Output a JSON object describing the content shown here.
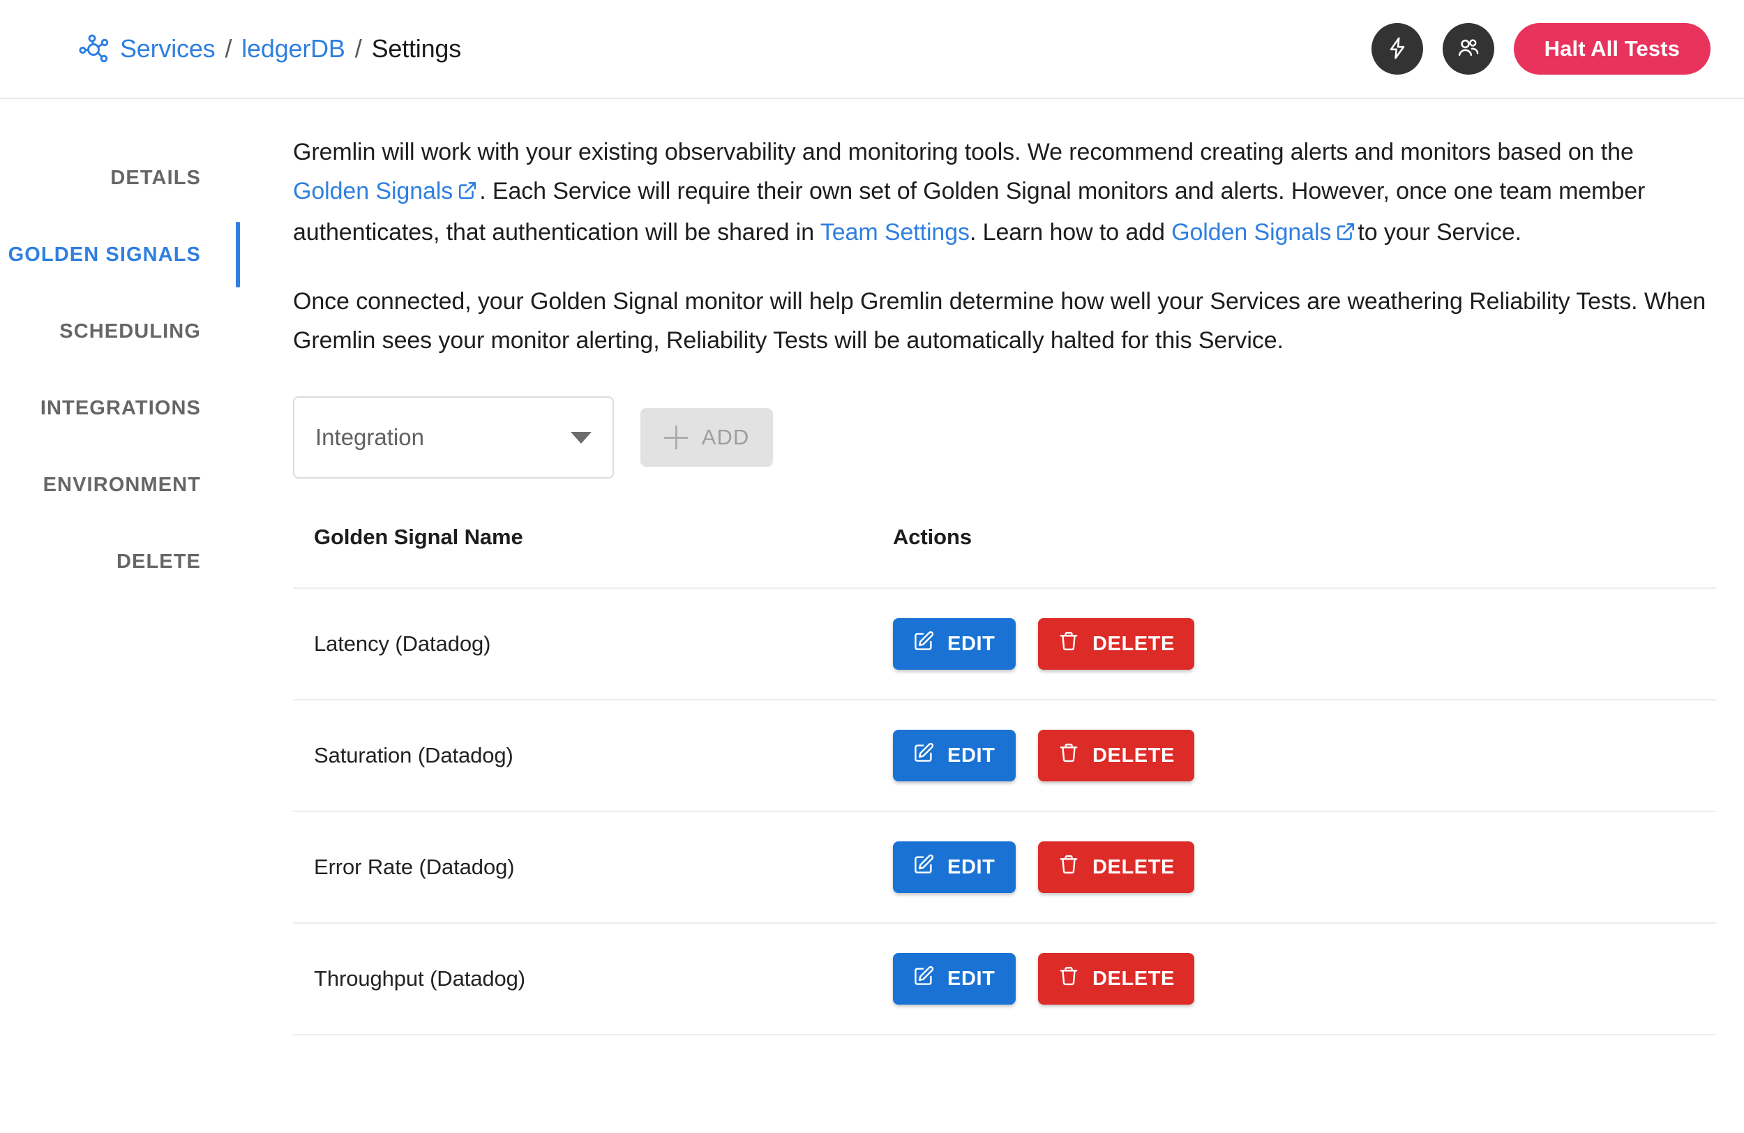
{
  "header": {
    "breadcrumb": {
      "icon": "services-graph-icon",
      "items": [
        {
          "label": "Services",
          "type": "link"
        },
        {
          "label": "ledgerDB",
          "type": "link"
        },
        {
          "label": "Settings",
          "type": "current"
        }
      ],
      "separator": "/"
    },
    "actions": {
      "lightning_icon": "lightning-bolt-icon",
      "team_icon": "users-icon",
      "halt_button": "Halt All Tests"
    }
  },
  "sidebar": {
    "items": [
      {
        "label": "DETAILS",
        "active": false
      },
      {
        "label": "GOLDEN SIGNALS",
        "active": true
      },
      {
        "label": "SCHEDULING",
        "active": false
      },
      {
        "label": "INTEGRATIONS",
        "active": false
      },
      {
        "label": "ENVIRONMENT",
        "active": false
      },
      {
        "label": "DELETE",
        "active": false
      }
    ],
    "active_color": "#2f7fe0"
  },
  "main": {
    "paragraph1": {
      "part1": "Gremlin will work with your existing observability and monitoring tools. We recommend creating alerts and monitors based on the ",
      "link1": "Golden Signals",
      "part2": ". Each Service will require their own set of Golden Signal monitors and alerts. However, once one team member authenticates, that authentication will be shared in ",
      "link2": "Team Settings",
      "part3": ". Learn how to add ",
      "link3": "Golden Signals",
      "part4": "to your Service."
    },
    "paragraph2": "Once connected, your Golden Signal monitor will help Gremlin determine how well your Services are weathering Reliability Tests. When Gremlin sees your monitor alerting, Reliability Tests will be automatically halted for this Service.",
    "controls": {
      "dropdown_value": "Integration",
      "dropdown_caret_icon": "chevron-down-icon",
      "add_label": "ADD",
      "add_plus_icon": "plus-icon",
      "add_disabled": true
    },
    "table": {
      "columns": [
        "Golden Signal Name",
        "Actions"
      ],
      "rows": [
        {
          "name": "Latency (Datadog)",
          "edit": "EDIT",
          "delete": "DELETE"
        },
        {
          "name": "Saturation (Datadog)",
          "edit": "EDIT",
          "delete": "DELETE"
        },
        {
          "name": "Error Rate (Datadog)",
          "edit": "EDIT",
          "delete": "DELETE"
        },
        {
          "name": "Throughput (Datadog)",
          "edit": "EDIT",
          "delete": "DELETE"
        }
      ],
      "edit_icon": "pencil-edit-icon",
      "delete_icon": "trash-icon"
    }
  },
  "colors": {
    "link": "#2f7fe0",
    "halt": "#e8335d",
    "edit": "#1a73d4",
    "delete": "#dd2b28",
    "icon_circle": "#333333"
  }
}
